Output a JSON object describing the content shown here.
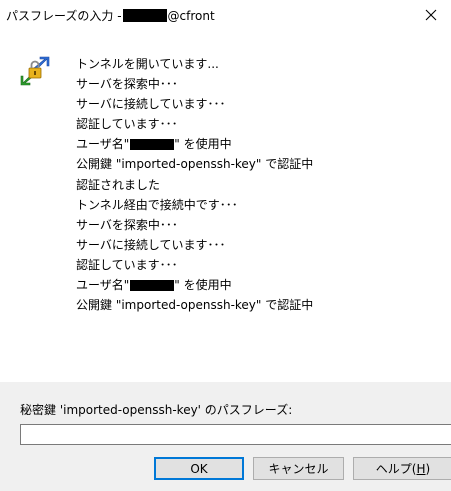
{
  "window": {
    "title_prefix": "パスフレーズの入力 - ",
    "title_suffix": "@cfront"
  },
  "icons": {
    "close": "close-icon",
    "app": "putty-key-tunnel-icon"
  },
  "log": {
    "lines": [
      {
        "text": "トンネルを開いています..."
      },
      {
        "text": "サーバを探索中･･･"
      },
      {
        "text": "サーバに接続しています･･･"
      },
      {
        "text": "認証しています･･･"
      },
      {
        "prefix": "ユーザ名\"",
        "suffix": "\" を使用中"
      },
      {
        "text": "公開鍵 \"imported-openssh-key\" で認証中"
      },
      {
        "text": "認証されました"
      },
      {
        "text": "トンネル経由で接続中です･･･"
      },
      {
        "text": "サーバを探索中･･･"
      },
      {
        "text": "サーバに接続しています･･･"
      },
      {
        "text": "認証しています･･･"
      },
      {
        "prefix": "ユーザ名\"",
        "suffix": "\" を使用中"
      },
      {
        "text": "公開鍵 \"imported-openssh-key\" で認証中"
      }
    ]
  },
  "prompt": {
    "label": "秘密鍵 'imported-openssh-key' のパスフレーズ:",
    "value": ""
  },
  "buttons": {
    "ok": "OK",
    "cancel": "キャンセル",
    "help_label": "ヘルプ(",
    "help_key": "H",
    "help_close": ")"
  },
  "colors": {
    "focus_border": "#0078d7",
    "panel_background": "#f0f0f0"
  }
}
